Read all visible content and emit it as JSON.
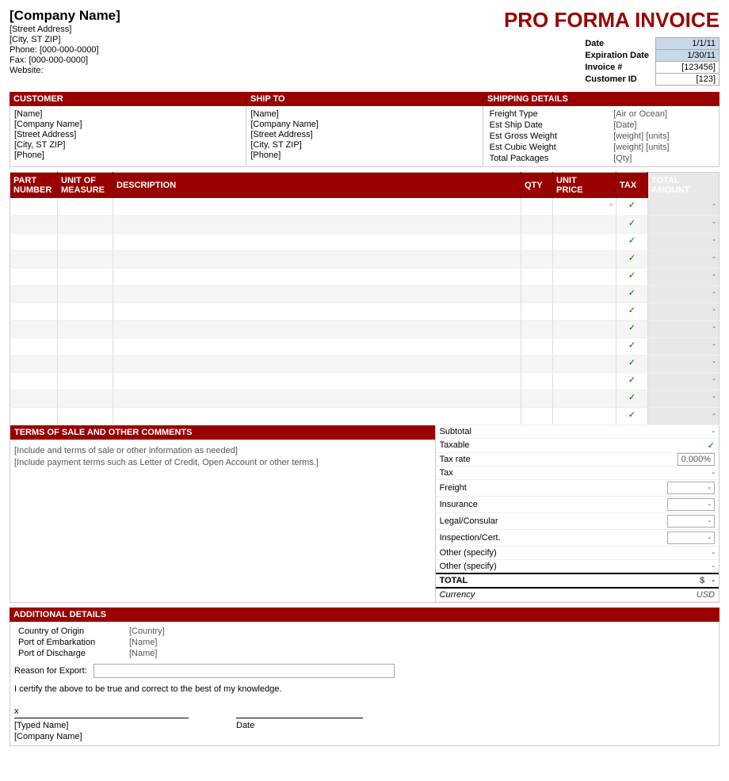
{
  "company": {
    "name": "[Company Name]",
    "street": "[Street Address]",
    "city": "[City, ST  ZIP]",
    "phone": "Phone: [000-000-0000]",
    "fax": "Fax: [000-000-0000]",
    "website": "Website:"
  },
  "title": "PRO FORMA INVOICE",
  "header_fields": {
    "date_label": "Date",
    "date_value": "1/1/11",
    "expiration_label": "Expiration Date",
    "expiration_value": "1/30/11",
    "invoice_label": "Invoice #",
    "invoice_value": "[123456]",
    "customer_id_label": "Customer ID",
    "customer_id_value": "[123]"
  },
  "customer": {
    "header": "CUSTOMER",
    "name": "[Name]",
    "company": "[Company Name]",
    "street": "[Street Address]",
    "city": "[City, ST  ZIP]",
    "phone": "[Phone]"
  },
  "ship_to": {
    "header": "SHIP TO",
    "name": "[Name]",
    "company": "[Company Name]",
    "street": "[Street Address]",
    "city": "[City, ST  ZIP]",
    "phone": "[Phone]"
  },
  "shipping": {
    "header": "SHIPPING DETAILS",
    "freight_type_label": "Freight Type",
    "freight_type_value": "[Air or Ocean]",
    "ship_date_label": "Est Ship Date",
    "ship_date_value": "[Date]",
    "gross_weight_label": "Est Gross Weight",
    "gross_weight_value": "[weight] [units]",
    "cubic_weight_label": "Est Cubic Weight",
    "cubic_weight_value": "[weight] [units]",
    "packages_label": "Total Packages",
    "packages_value": "[Qty]"
  },
  "table": {
    "headers": {
      "part": "PART\nNUMBER",
      "uom": "UNIT OF\nMEASURE",
      "desc": "DESCRIPTION",
      "qty": "QTY",
      "price": "UNIT\nPRICE",
      "tax": "TAX",
      "total": "TOTAL AMOUNT"
    },
    "rows": [
      {
        "part": "",
        "uom": "",
        "desc": "",
        "qty": "",
        "price": "-",
        "tax": "✓",
        "total": "-"
      },
      {
        "part": "",
        "uom": "",
        "desc": "",
        "qty": "",
        "price": "",
        "tax": "✓",
        "total": "-"
      },
      {
        "part": "",
        "uom": "",
        "desc": "",
        "qty": "",
        "price": "",
        "tax": "✓",
        "total": "-"
      },
      {
        "part": "",
        "uom": "",
        "desc": "",
        "qty": "",
        "price": "",
        "tax": "✓",
        "total": "-"
      },
      {
        "part": "",
        "uom": "",
        "desc": "",
        "qty": "",
        "price": "",
        "tax": "✓",
        "total": "-"
      },
      {
        "part": "",
        "uom": "",
        "desc": "",
        "qty": "",
        "price": "",
        "tax": "✓",
        "total": "-"
      },
      {
        "part": "",
        "uom": "",
        "desc": "",
        "qty": "",
        "price": "",
        "tax": "✓",
        "total": "-"
      },
      {
        "part": "",
        "uom": "",
        "desc": "",
        "qty": "",
        "price": "",
        "tax": "✓",
        "total": "-"
      },
      {
        "part": "",
        "uom": "",
        "desc": "",
        "qty": "",
        "price": "",
        "tax": "✓",
        "total": "-"
      },
      {
        "part": "",
        "uom": "",
        "desc": "",
        "qty": "",
        "price": "",
        "tax": "✓",
        "total": "-"
      },
      {
        "part": "",
        "uom": "",
        "desc": "",
        "qty": "",
        "price": "",
        "tax": "✓",
        "total": "-"
      },
      {
        "part": "",
        "uom": "",
        "desc": "",
        "qty": "",
        "price": "",
        "tax": "✓",
        "total": "-"
      },
      {
        "part": "",
        "uom": "",
        "desc": "",
        "qty": "",
        "price": "",
        "tax": "✓",
        "total": "-"
      }
    ]
  },
  "terms": {
    "header": "TERMS OF SALE AND OTHER COMMENTS",
    "line1": "[Include and terms of sale or other information as needed]",
    "line2": "[Include payment terms such as Letter of Credit, Open Account or other terms.]"
  },
  "totals": {
    "subtotal_label": "Subtotal",
    "subtotal_value": "-",
    "taxable_label": "Taxable",
    "taxable_value": "✓",
    "taxrate_label": "Tax rate",
    "taxrate_value": "0.000%",
    "tax_label": "Tax",
    "tax_value": "-",
    "freight_label": "Freight",
    "freight_value": "-",
    "insurance_label": "Insurance",
    "insurance_value": "-",
    "legal_label": "Legal/Consular",
    "legal_value": "-",
    "inspection_label": "Inspection/Cert.",
    "inspection_value": "-",
    "other1_label": "Other (specify)",
    "other1_value": "-",
    "other2_label": "Other (specify)",
    "other2_value": "-",
    "total_label": "TOTAL",
    "total_dollar": "$",
    "total_value": "-",
    "currency_label": "Currency",
    "currency_value": "USD"
  },
  "additional": {
    "header": "ADDITIONAL DETAILS",
    "origin_label": "Country of Origin",
    "origin_value": "[Country]",
    "embarkation_label": "Port of Embarkation",
    "embarkation_value": "[Name]",
    "discharge_label": "Port of Discharge",
    "discharge_value": "[Name]",
    "reason_label": "Reason for Export:",
    "certify_text": "I certify the above to be true and correct to the best of my knowledge.",
    "x_label": "x",
    "sig_line1_label": "[Typed Name]",
    "sig_line2_label": "[Company Name]",
    "date_label": "Date"
  }
}
